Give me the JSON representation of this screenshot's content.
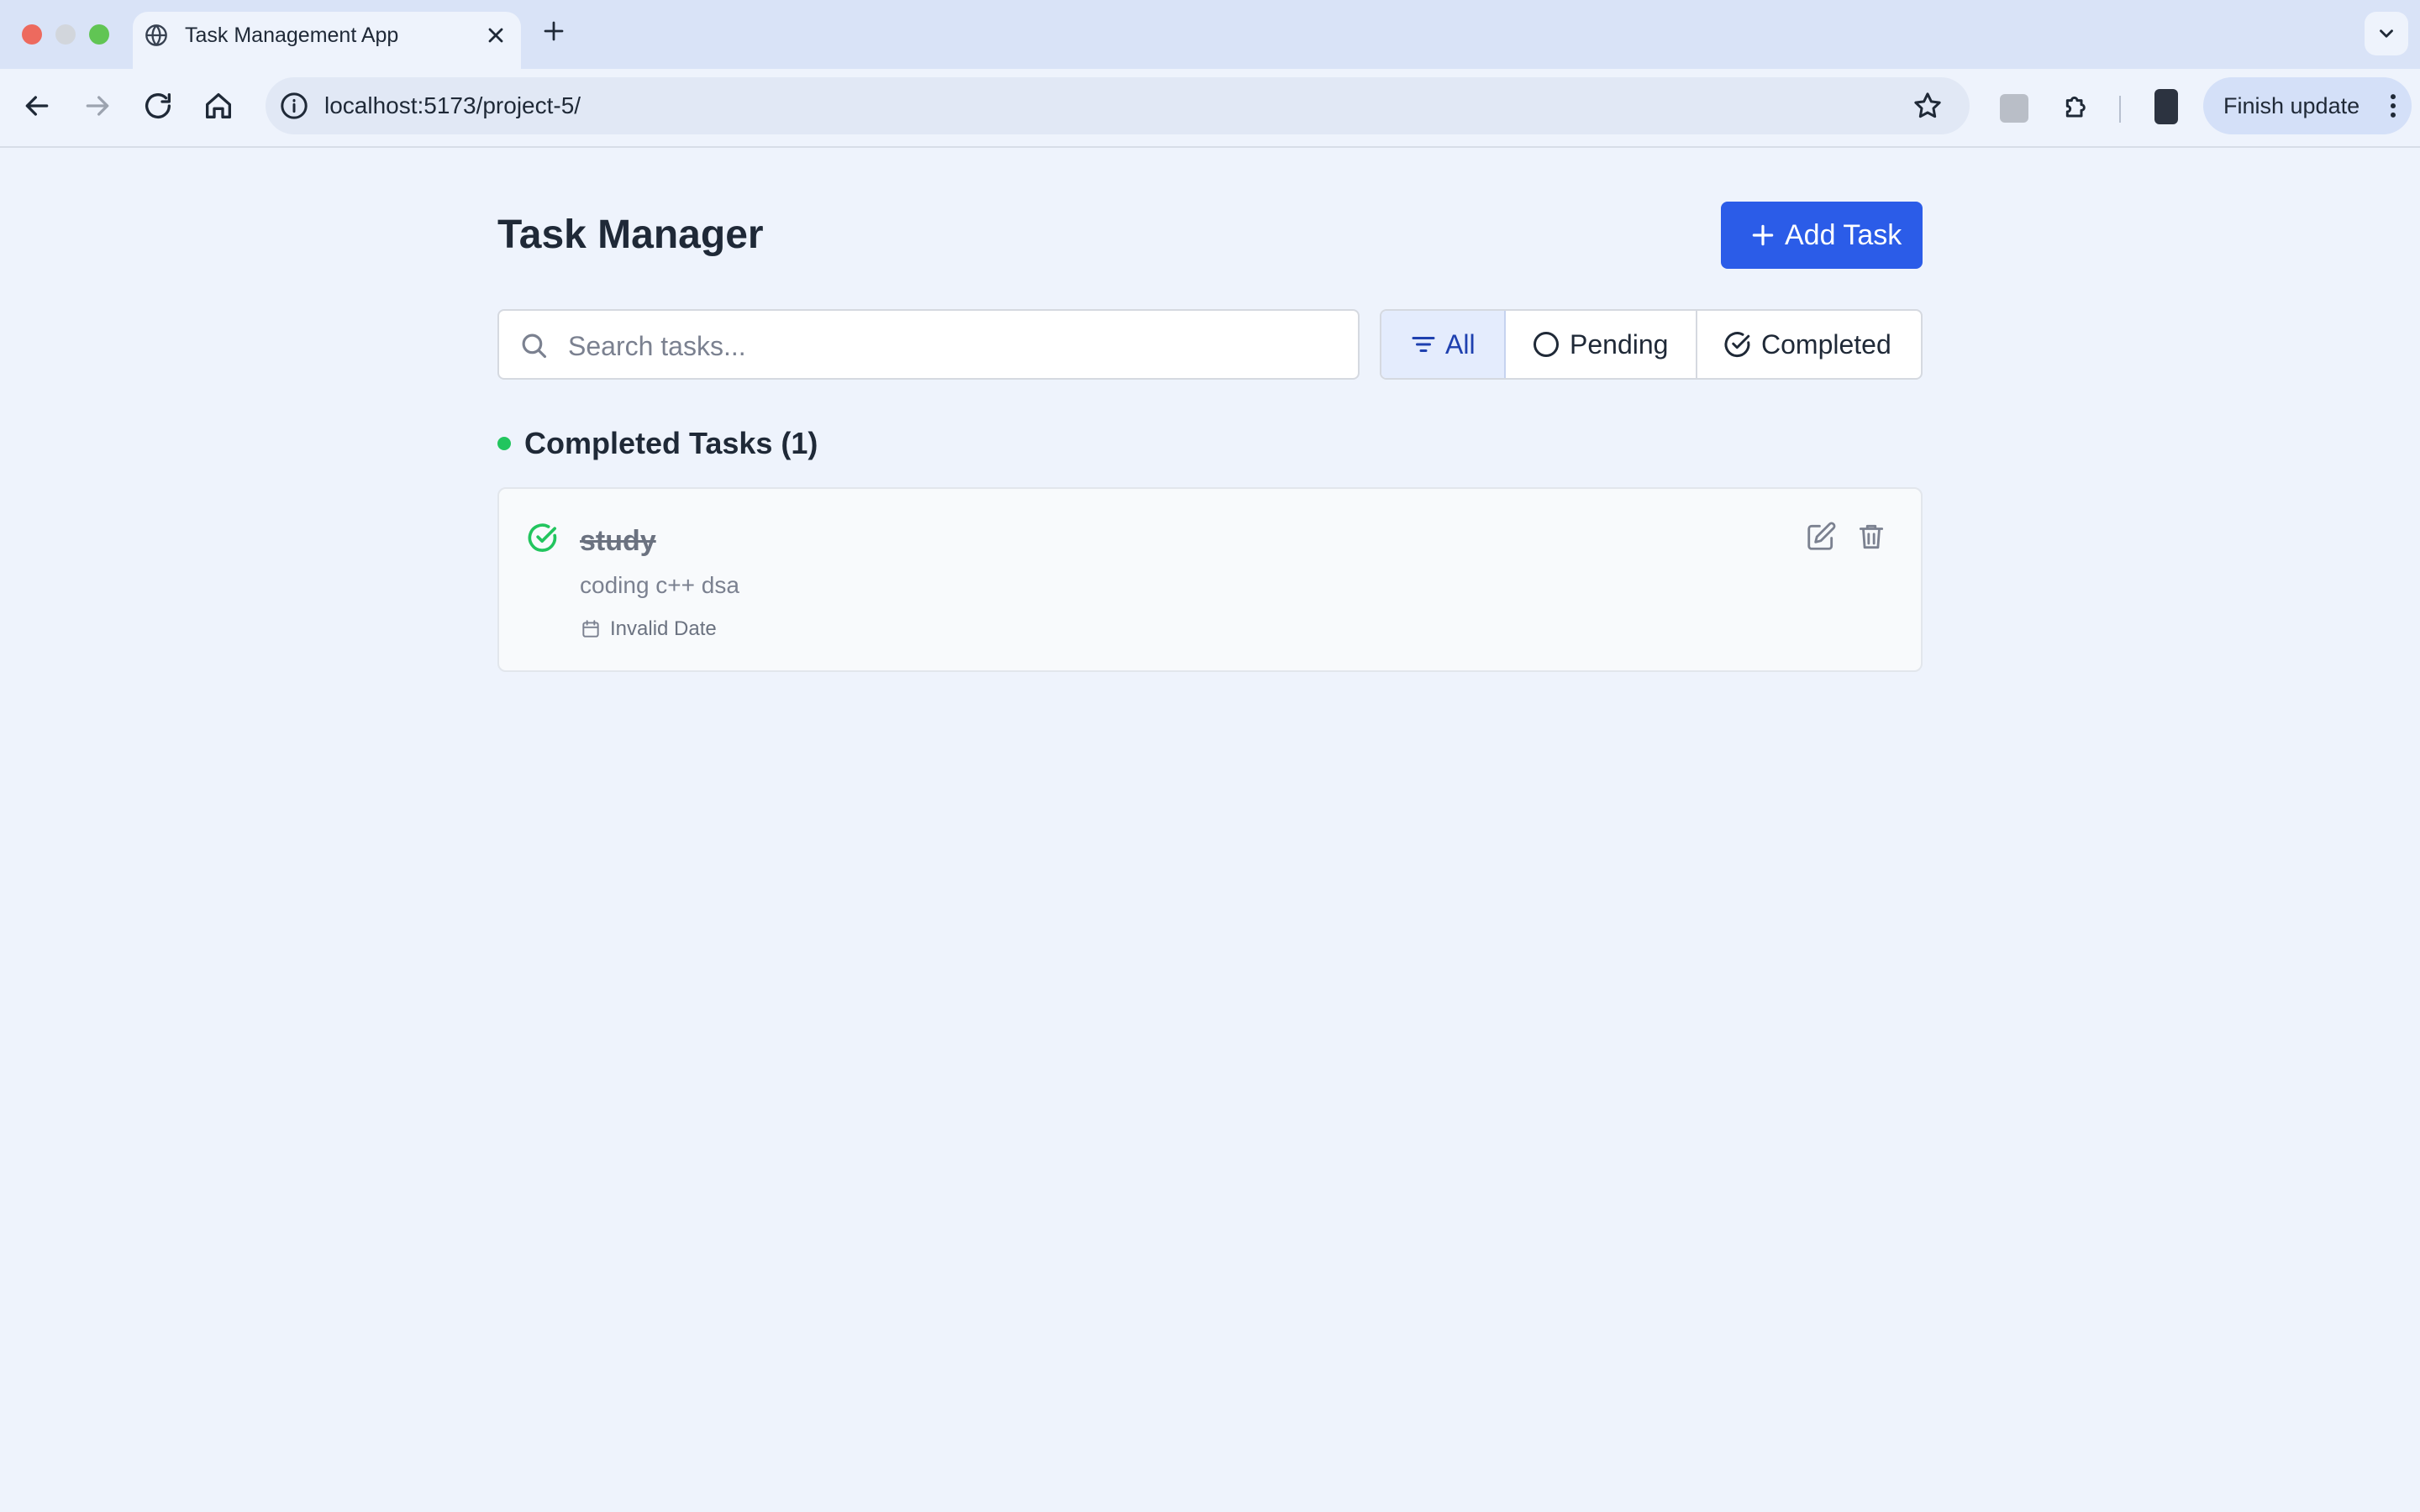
{
  "browser": {
    "tab_title": "Task Management App",
    "url": "localhost:5173/project-5/",
    "finish_update_label": "Finish update",
    "icons": [
      "globe-icon",
      "close-icon",
      "plus-icon",
      "chevron-down-icon",
      "back-arrow-icon",
      "forward-arrow-icon",
      "reload-icon",
      "home-icon",
      "info-icon",
      "star-icon",
      "puzzle-icon",
      "more-vert-icon"
    ]
  },
  "header": {
    "title": "Task Manager",
    "add_task_label": "Add Task"
  },
  "search": {
    "placeholder": "Search tasks...",
    "value": ""
  },
  "filters": {
    "selected": "All",
    "items": [
      {
        "label": "All",
        "icon": "filter-icon"
      },
      {
        "label": "Pending",
        "icon": "circle-icon"
      },
      {
        "label": "Completed",
        "icon": "check-circle-icon"
      }
    ]
  },
  "section": {
    "title": "Completed Tasks (1)"
  },
  "tasks": [
    {
      "title": "study",
      "description": "coding c++ dsa",
      "date": "Invalid Date",
      "completed": true
    }
  ],
  "colors": {
    "accent": "#2b5ce8",
    "completed_green": "#22c55e",
    "page_background": "#eef3fc",
    "selected_filter_bg": "#e4ecfd"
  }
}
